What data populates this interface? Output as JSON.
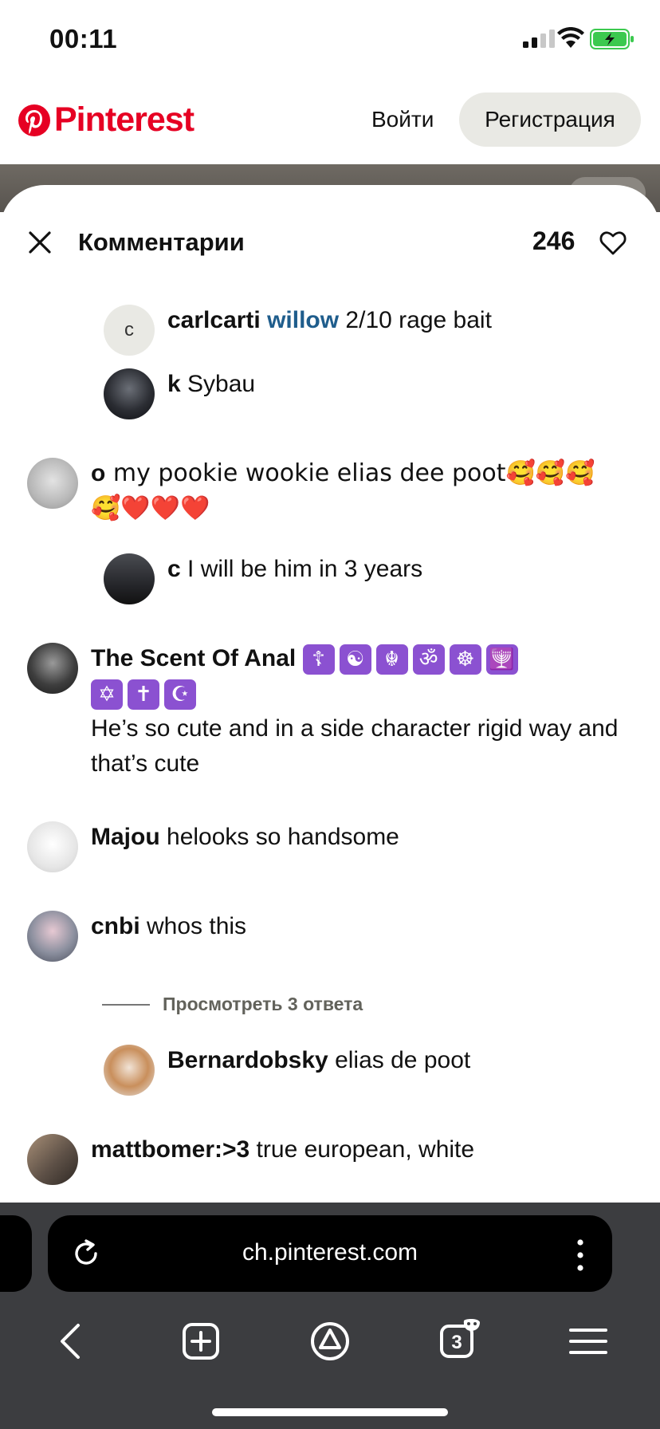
{
  "status": {
    "time": "00:11"
  },
  "header": {
    "brand": "Pinterest",
    "login": "Войти",
    "signup": "Регистрация"
  },
  "sheet": {
    "title": "Комментарии",
    "like_count": "246"
  },
  "comments": [
    {
      "author": "carlcarti",
      "mention": "willow",
      "text": " 2/10 rage bait",
      "avatar_letter": "c"
    },
    {
      "author": "k",
      "text": " Sybau"
    },
    {
      "author": "o",
      "text": " my pookie wookie elias dee poot🥰🥰🥰",
      "text2": "🥰❤️❤️❤️"
    },
    {
      "author": "c",
      "text": " I will be him in 3 years"
    },
    {
      "author": "The Scent Of Anal",
      "symbols": [
        "☦",
        "☯",
        "☬",
        "ॐ",
        "☸",
        "🕎",
        "✡",
        "✝",
        "☪"
      ],
      "text": "He’s so cute and in a side character rigid way and that’s cute"
    },
    {
      "author": "Majou",
      "text": " helooks so handsome"
    },
    {
      "author": "cnbi",
      "text": " whos this"
    },
    {
      "author": "Bernardobsky",
      "text": " elias de poot"
    },
    {
      "author": "mattbomer:>3",
      "text": " true european, white"
    }
  ],
  "view_replies": "Просмотреть 3 ответа",
  "browser": {
    "url": "ch.pinterest.com",
    "tab_count": "3"
  },
  "colors": {
    "brand": "#e60023",
    "mention": "#1f5d8c",
    "symbol_bg": "#8b51d1",
    "browser_bg": "#3c3d40"
  }
}
